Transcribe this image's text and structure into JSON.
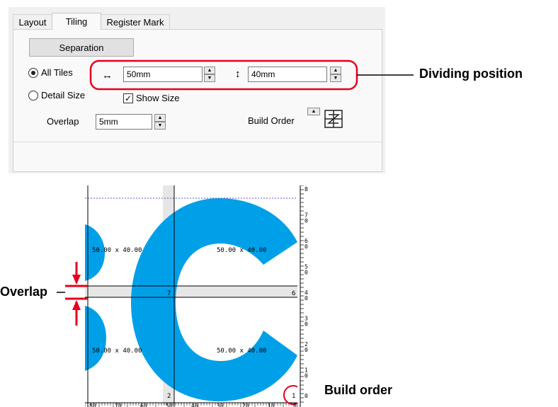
{
  "tabs": [
    "Layout",
    "Tiling",
    "Register Mark"
  ],
  "separation_button": "Separation",
  "radio_all_tiles": "All Tiles",
  "radio_detail_size": "Detail Size",
  "width_value": "50mm",
  "height_value": "40mm",
  "horizontal_arrow": "↔",
  "vertical_arrow": "↕",
  "show_size_label": "Show Size",
  "overlap_label": "Overlap",
  "overlap_value": "5mm",
  "build_order_label": "Build Order",
  "callouts": {
    "dividing_position": "Dividing position",
    "overlap": "Overlap",
    "build_order": "Build order"
  },
  "preview": {
    "tile_size": "50.00 x 40.00",
    "tile_numbers": [
      "7",
      "6",
      "2",
      "1"
    ],
    "ruler_x": [
      "80",
      "70",
      "60",
      "50",
      "40",
      "30",
      "20",
      "10",
      "0"
    ],
    "ruler_y": [
      "8",
      "7\n0",
      "6\n0",
      "5\n0",
      "4\n0",
      "3\n0",
      "2\n0",
      "1\n0",
      "0"
    ],
    "accent_color": "#00a0e9",
    "annotation_color": "#e6001e"
  }
}
